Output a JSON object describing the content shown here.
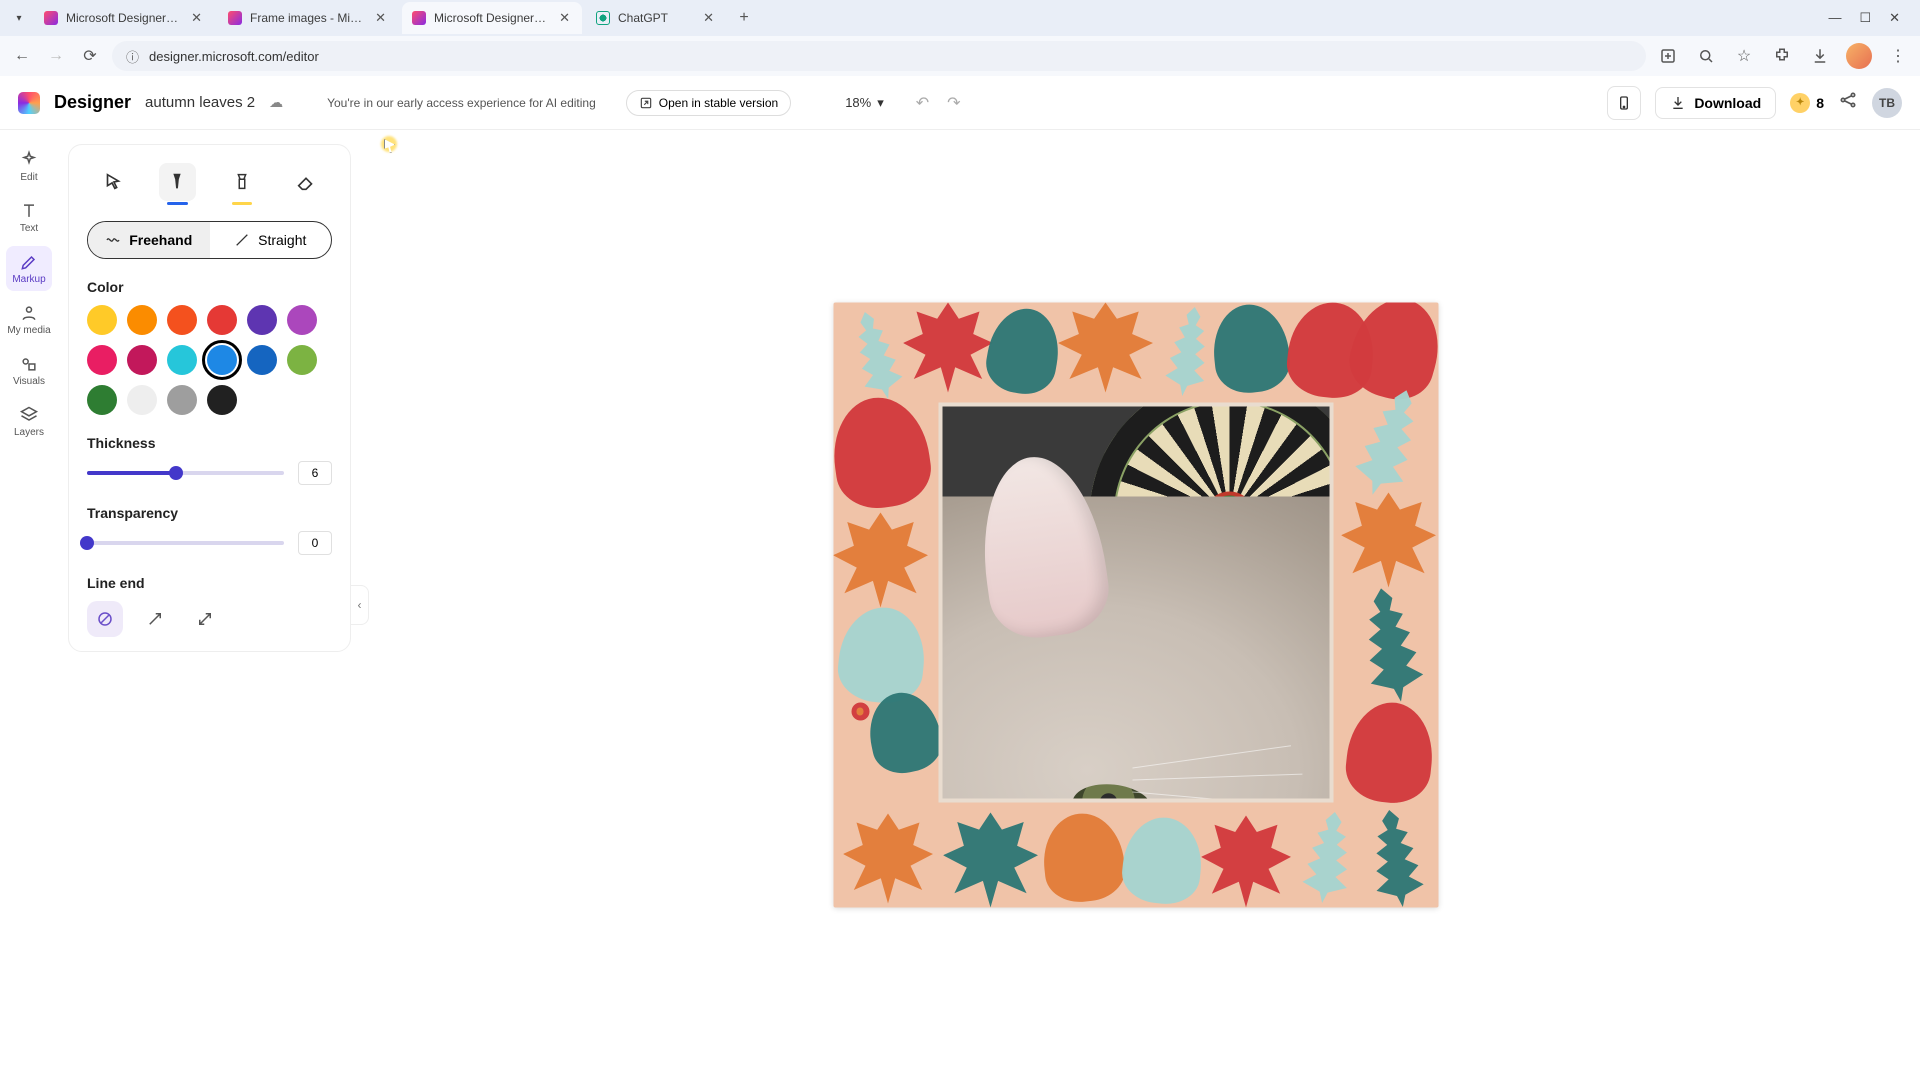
{
  "browser": {
    "tabs": [
      {
        "title": "Microsoft Designer - Stunning",
        "favicon": "designer"
      },
      {
        "title": "Frame images - Microsoft Des...",
        "favicon": "designer"
      },
      {
        "title": "Microsoft Designer - Stunning",
        "favicon": "designer",
        "active": true
      },
      {
        "title": "ChatGPT",
        "favicon": "chatgpt"
      }
    ],
    "url": "designer.microsoft.com/editor"
  },
  "app": {
    "name": "Designer",
    "project": "autumn leaves 2",
    "notice": "You're in our early access experience for AI editing",
    "open_stable": "Open in stable version",
    "zoom": "18%",
    "download": "Download",
    "credits": "8",
    "user_initials": "TB"
  },
  "rail": {
    "items": [
      {
        "id": "edit",
        "label": "Edit"
      },
      {
        "id": "text",
        "label": "Text"
      },
      {
        "id": "markup",
        "label": "Markup",
        "active": true
      },
      {
        "id": "mymedia",
        "label": "My media"
      },
      {
        "id": "visuals",
        "label": "Visuals"
      },
      {
        "id": "layers",
        "label": "Layers"
      }
    ]
  },
  "markup": {
    "tools": [
      "select",
      "marker",
      "highlighter",
      "eraser"
    ],
    "active_tool": "marker",
    "mode": {
      "freehand": "Freehand",
      "straight": "Straight",
      "active": "freehand"
    },
    "labels": {
      "color": "Color",
      "thickness": "Thickness",
      "transparency": "Transparency",
      "line_end": "Line end"
    },
    "colors": [
      "#ffca28",
      "#fb8c00",
      "#f4511e",
      "#e53935",
      "#5e35b1",
      "#ab47bc",
      "#e91e63",
      "#c2185b",
      "#26c6da",
      "#1e88e5",
      "#1565c0",
      "#7cb342",
      "#2e7d32",
      "#eeeeee",
      "#9e9e9e",
      "#212121"
    ],
    "selected_color_index": 9,
    "thickness": {
      "value": "6",
      "min": 1,
      "max": 20,
      "fill_pct": 45
    },
    "transparency": {
      "value": "0",
      "min": 0,
      "max": 100,
      "fill_pct": 0
    },
    "line_end": {
      "options": [
        "none",
        "arrow",
        "double-arrow"
      ],
      "active": "none"
    }
  }
}
